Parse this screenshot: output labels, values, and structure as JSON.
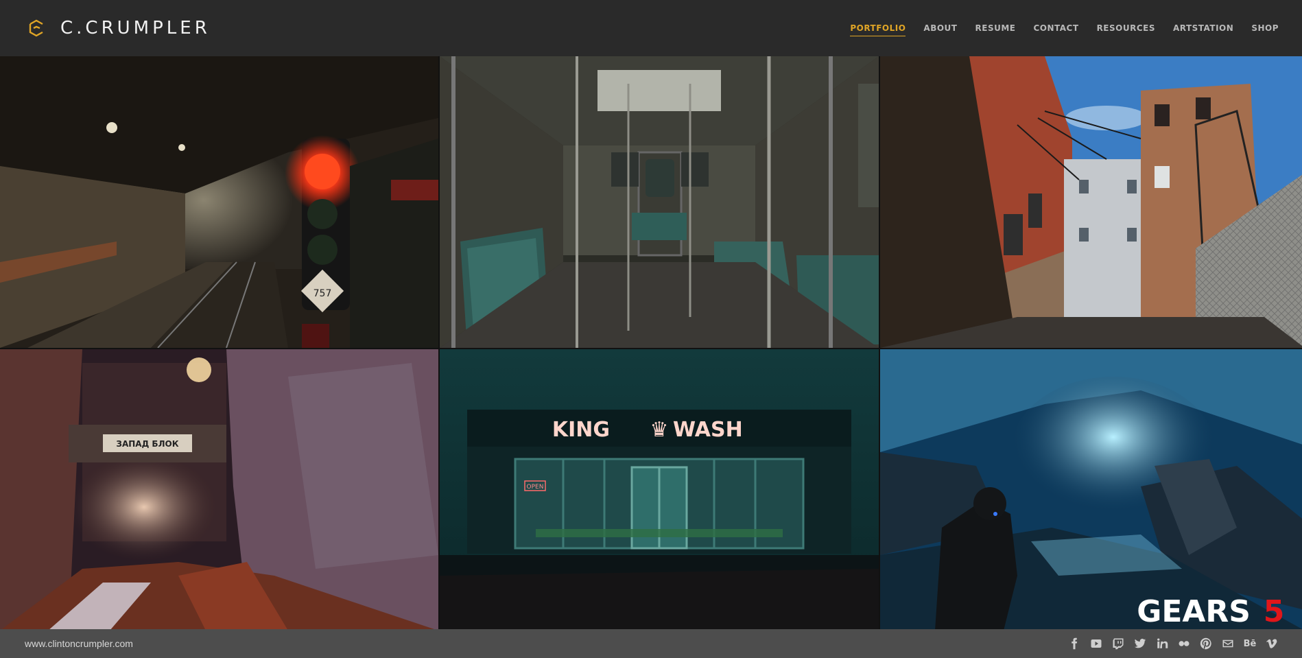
{
  "header": {
    "brand": "C.CRUMPLER",
    "nav": [
      {
        "label": "PORTFOLIO",
        "active": true
      },
      {
        "label": "ABOUT"
      },
      {
        "label": "RESUME"
      },
      {
        "label": "CONTACT"
      },
      {
        "label": "RESOURCES"
      },
      {
        "label": "ARTSTATION"
      },
      {
        "label": "SHOP"
      }
    ],
    "accent_color": "#e0a526"
  },
  "gallery": {
    "tiles": [
      {
        "subject": "subway-tunnel-signal"
      },
      {
        "subject": "subway-car-interior"
      },
      {
        "subject": "brick-alley"
      },
      {
        "subject": "mine-tunnel"
      },
      {
        "subject": "laundromat-night",
        "sign_text_left": "KING",
        "sign_text_right": "WASH",
        "open_sign": "OPEN"
      },
      {
        "subject": "ice-cave-gears5",
        "logo_text": "GEARS",
        "logo_number": "5"
      }
    ],
    "signal_plate": "757",
    "mine_sign": "ЗАПАД БЛОК"
  },
  "footer": {
    "url": "www.clintoncrumpler.com",
    "socials": [
      "facebook-icon",
      "youtube-icon",
      "twitch-icon",
      "twitter-icon",
      "linkedin-icon",
      "flickr-icon",
      "pinterest-icon",
      "email-icon",
      "behance-icon",
      "vimeo-icon"
    ],
    "behance_text": "Bē"
  }
}
